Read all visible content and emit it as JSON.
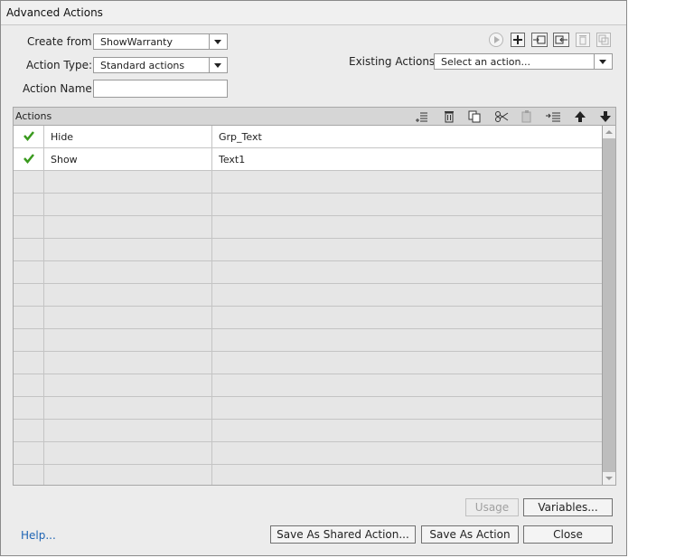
{
  "window": {
    "title": "Advanced Actions"
  },
  "form": {
    "create_from_label": "Create from:",
    "create_from_value": "ShowWarranty",
    "action_type_label": "Action Type:",
    "action_type_value": "Standard actions",
    "action_name_label": "Action Name:",
    "action_name_value": "",
    "existing_actions_label": "Existing Actions:",
    "existing_actions_value": "Select an action..."
  },
  "toolbar_icons": [
    "preview-icon",
    "add-icon",
    "import-icon",
    "export-icon",
    "delete-icon",
    "duplicate-icon"
  ],
  "actions_panel": {
    "title": "Actions",
    "icons": [
      "insert-icon",
      "delete-icon",
      "copy-icon",
      "cut-icon",
      "paste-icon",
      "indent-icon",
      "move-up-icon",
      "move-down-icon"
    ],
    "rows": [
      {
        "status_icon": "check-icon",
        "action": "Hide",
        "target": "Grp_Text"
      },
      {
        "status_icon": "check-icon",
        "action": "Show",
        "target": "Text1"
      }
    ]
  },
  "buttons": {
    "usage": "Usage",
    "variables": "Variables...",
    "save_shared": "Save As Shared Action...",
    "save_action": "Save As Action",
    "close": "Close"
  },
  "help_link": "Help...",
  "colors": {
    "check": "#3a9a1e",
    "link": "#1e64b4",
    "dialog_bg": "#ececec"
  }
}
